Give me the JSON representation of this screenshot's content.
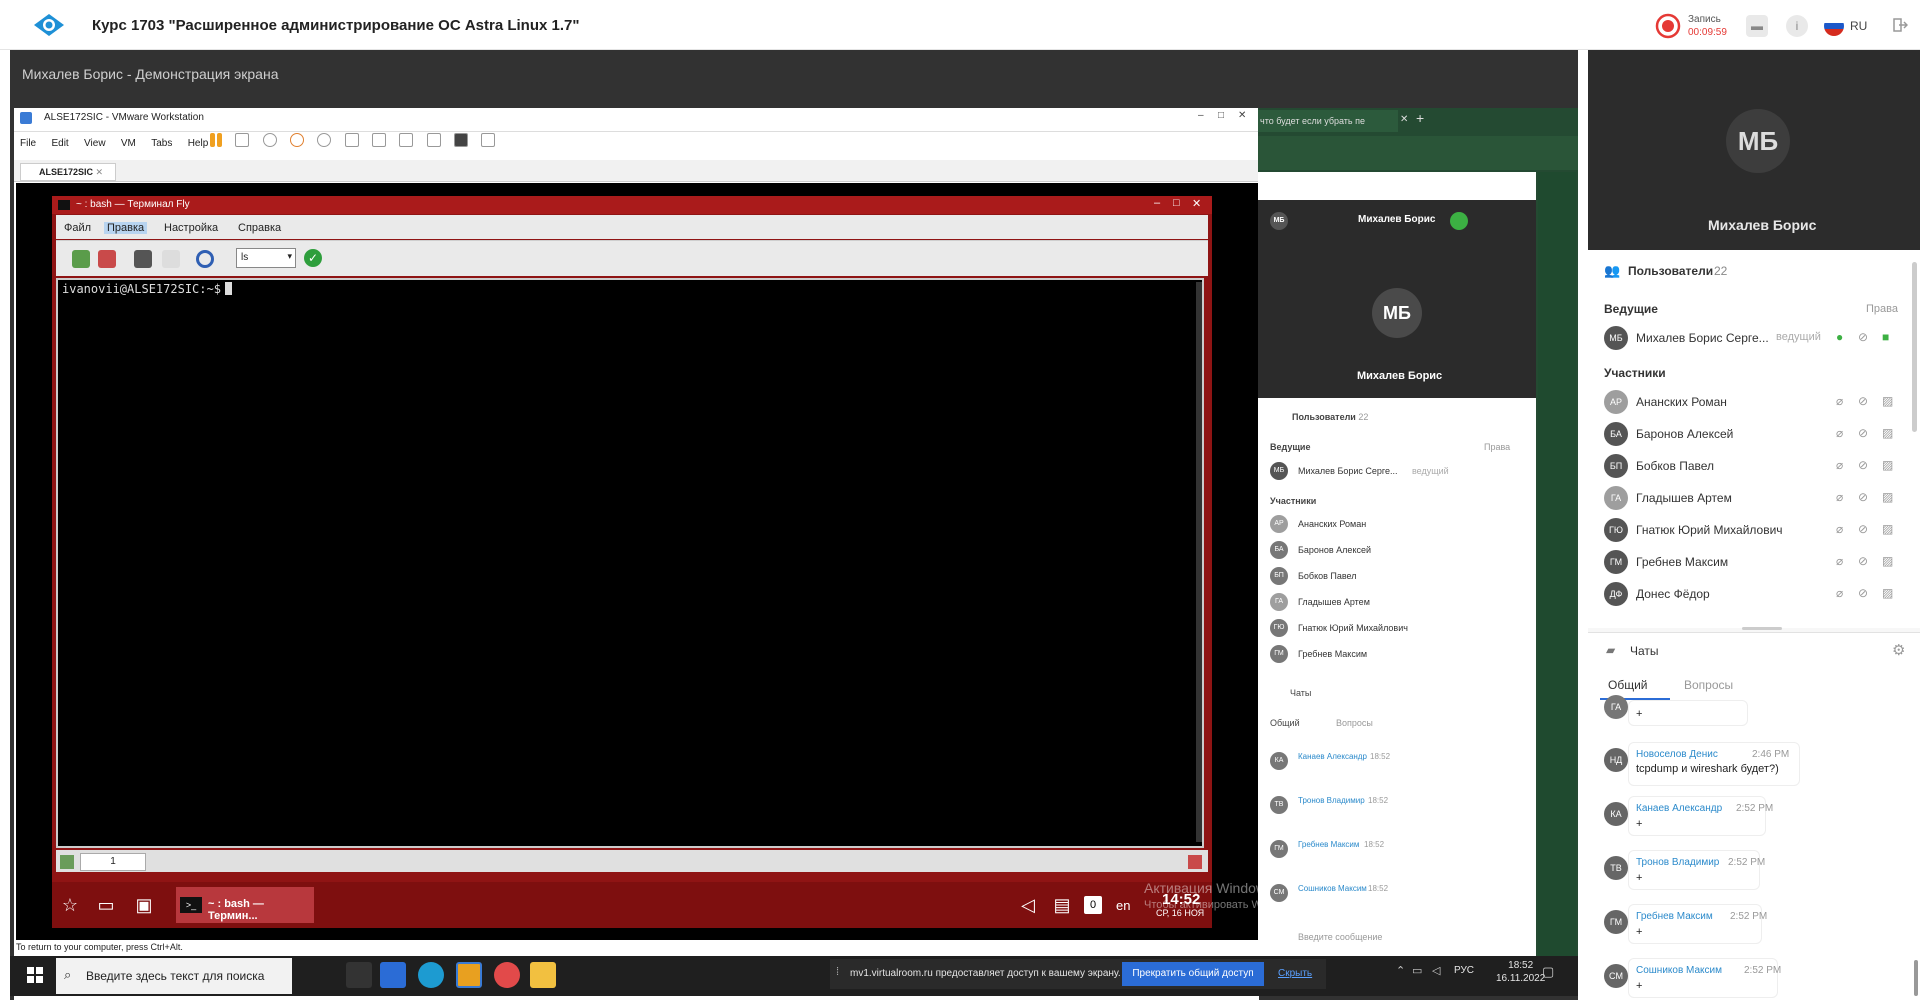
{
  "header": {
    "course_title": "Курс 1703 \"Расширенное администрирование ОС Astra Linux 1.7\"",
    "record_label": "Запись",
    "record_time": "00:09:59",
    "language": "RU"
  },
  "stage": {
    "demo_title": "Михалев Борис - Демонстрация экрана"
  },
  "vmware": {
    "title": "ALSE172SIC - VMware Workstation",
    "menu": [
      "File",
      "Edit",
      "View",
      "VM",
      "Tabs",
      "Help"
    ],
    "tab": "ALSE172SIC",
    "hint": "To return to your computer, press Ctrl+Alt."
  },
  "terminal": {
    "title": "~ : bash — Терминал Fly",
    "menu": {
      "file": "Файл",
      "edit": "Правка",
      "settings": "Настройка",
      "help": "Справка"
    },
    "command_combo": "ls",
    "prompt": "ivanovii@ALSE172SIC:~$",
    "tab1": "1"
  },
  "fly_taskbar": {
    "task": "~ : bash — Термин...",
    "kbd_indicator": "0",
    "lang": "en",
    "time": "14:52",
    "date": "СР, 16 НОЯ",
    "activate_line1": "Активация Windows",
    "activate_line2": "Чтобы активировать Windows, перейдите в раздел \"Параметры\"."
  },
  "win_taskbar": {
    "search_placeholder": "Введите здесь текст для поиска",
    "share_notice": "mv1.virtualroom.ru предоставляет доступ к вашему экрану.",
    "stop_share": "Прекратить общий доступ",
    "hide": "Скрыть",
    "lang": "РУС",
    "time": "18:52",
    "date": "16.11.2022"
  },
  "inner_browser": {
    "tab_title": "что будет если убрать пе",
    "host_short": "Михалев Борис",
    "avatar": "МБ",
    "users_label": "Пользователи",
    "users_count": "22",
    "hosts_label": "Ведущие",
    "rights": "Права",
    "host_row": "Михалев Борис Серге...",
    "host_role": "ведущий",
    "participants_label": "Участники",
    "participants": [
      {
        "initials": "АР",
        "name": "Ананских Роман"
      },
      {
        "initials": "БА",
        "name": "Баронов Алексей"
      },
      {
        "initials": "БП",
        "name": "Бобков Павел"
      },
      {
        "initials": "ГА",
        "name": "Гладышев Артем"
      },
      {
        "initials": "ГЮ",
        "name": "Гнатюк Юрий Михайлович"
      },
      {
        "initials": "ГМ",
        "name": "Гребнев Максим"
      }
    ],
    "chats_label": "Чаты",
    "tab_general": "Общий",
    "tab_questions": "Вопросы",
    "messages": [
      {
        "initials": "КА",
        "name": "Канаев Александр",
        "time": "18:52"
      },
      {
        "initials": "ТВ",
        "name": "Тронов Владимир",
        "time": "18:52"
      },
      {
        "initials": "ГМ",
        "name": "Гребнев Максим",
        "time": "18:52"
      },
      {
        "initials": "СМ",
        "name": "Сошников Максим",
        "time": "18:52"
      }
    ],
    "message_placeholder": "Введите сообщение"
  },
  "right_panel": {
    "avatar": "МБ",
    "host_name": "Михалев Борис",
    "users_label": "Пользователи",
    "users_count": "22",
    "hosts_label": "Ведущие",
    "rights": "Права",
    "host_row": "Михалев Борис Серге...",
    "host_role": "ведущий",
    "participants_label": "Участники",
    "participants": [
      {
        "initials": "АР",
        "name": "Ананских Роман",
        "color": "#9e9e9e"
      },
      {
        "initials": "БА",
        "name": "Баронов Алексей",
        "color": "#555555"
      },
      {
        "initials": "БП",
        "name": "Бобков Павел",
        "color": "#555555"
      },
      {
        "initials": "ГА",
        "name": "Гладышев Артем",
        "color": "#9e9e9e"
      },
      {
        "initials": "ГЮ",
        "name": "Гнатюк Юрий Михайлович",
        "color": "#555555"
      },
      {
        "initials": "ГМ",
        "name": "Гребнев Максим",
        "color": "#555555"
      },
      {
        "initials": "ДФ",
        "name": "Донес Фёдор",
        "color": "#555555"
      }
    ],
    "chats_label": "Чаты",
    "tab_general": "Общий",
    "tab_questions": "Вопросы",
    "messages": [
      {
        "initials": "ГА",
        "name": "",
        "time": "",
        "text": "+"
      },
      {
        "initials": "НД",
        "name": "Новоселов Денис",
        "time": "2:46 PM",
        "text": "tcpdump и wireshark будет?)"
      },
      {
        "initials": "КА",
        "name": "Канаев Александр",
        "time": "2:52 PM",
        "text": "+"
      },
      {
        "initials": "ТВ",
        "name": "Тронов Владимир",
        "time": "2:52 PM",
        "text": "+"
      },
      {
        "initials": "ГМ",
        "name": "Гребнев Максим",
        "time": "2:52 PM",
        "text": "+"
      },
      {
        "initials": "СМ",
        "name": "Сошников Максим",
        "time": "2:52 PM",
        "text": "+"
      }
    ]
  },
  "colors": {
    "accent": "#2b6cd6",
    "fly_red": "#8f1414",
    "mic_green": "#3cb043",
    "record_red": "#e53935"
  }
}
